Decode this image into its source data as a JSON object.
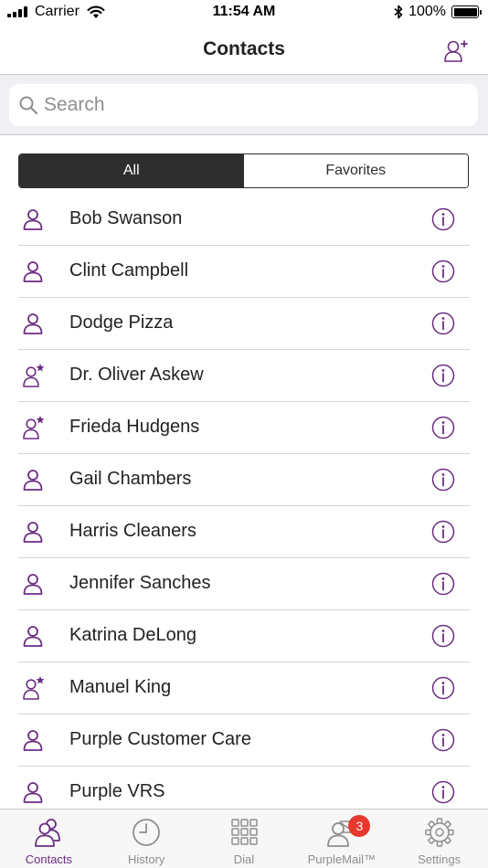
{
  "status_bar": {
    "carrier": "Carrier",
    "time": "11:54 AM",
    "battery_text": "100%",
    "battery_level": 1.0
  },
  "nav": {
    "title": "Contacts",
    "add_icon": "add-contact-icon"
  },
  "search": {
    "placeholder": "Search",
    "value": ""
  },
  "segments": [
    {
      "label": "All",
      "selected": true
    },
    {
      "label": "Favorites",
      "selected": false
    }
  ],
  "contacts": [
    {
      "name": "Bob Swanson",
      "icon": "person-icon"
    },
    {
      "name": "Clint Campbell",
      "icon": "person-icon"
    },
    {
      "name": "Dodge Pizza",
      "icon": "person-icon"
    },
    {
      "name": "Dr. Oliver Askew",
      "icon": "favorite-person-icon"
    },
    {
      "name": "Frieda Hudgens",
      "icon": "favorite-person-icon"
    },
    {
      "name": "Gail Chambers",
      "icon": "person-icon"
    },
    {
      "name": "Harris Cleaners",
      "icon": "person-icon"
    },
    {
      "name": "Jennifer Sanches",
      "icon": "person-icon"
    },
    {
      "name": "Katrina DeLong",
      "icon": "person-icon"
    },
    {
      "name": "Manuel King",
      "icon": "favorite-person-icon"
    },
    {
      "name": "Purple Customer Care",
      "icon": "person-icon"
    },
    {
      "name": "Purple VRS",
      "icon": "person-icon"
    }
  ],
  "tabs": [
    {
      "label": "Contacts",
      "icon": "contacts-icon",
      "active": true
    },
    {
      "label": "History",
      "icon": "clock-icon",
      "active": false
    },
    {
      "label": "Dial",
      "icon": "keypad-icon",
      "active": false
    },
    {
      "label": "PurpleMail™",
      "icon": "purplemail-icon",
      "active": false,
      "badge": "3"
    },
    {
      "label": "Settings",
      "icon": "gear-icon",
      "active": false
    }
  ],
  "colors": {
    "accent": "#6b2d82",
    "segment_dark": "#2e2e2e",
    "badge": "#e8372c",
    "tab_inactive": "#8e8e93"
  }
}
